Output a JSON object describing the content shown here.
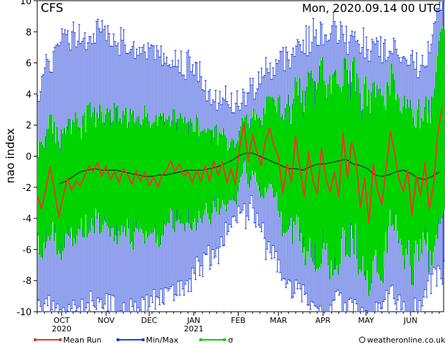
{
  "chart_data": {
    "type": "line",
    "title": "CFS",
    "run_label": "Mon, 2020.09.14   00 UTC",
    "ylabel": "nao index",
    "ylim": [
      -10,
      10
    ],
    "yticks": [
      "-10",
      "-8",
      "-6",
      "-4",
      "-2",
      "0",
      "2",
      "4",
      "6",
      "8",
      "10"
    ],
    "xlim_days": [
      0,
      283
    ],
    "month_ticks": [
      {
        "label": "OCT",
        "year": "2020",
        "day": 17
      },
      {
        "label": "NOV",
        "year": "",
        "day": 48
      },
      {
        "label": "DEC",
        "year": "",
        "day": 78
      },
      {
        "label": "JAN",
        "year": "2021",
        "day": 109
      },
      {
        "label": "FEB",
        "year": "",
        "day": 140
      },
      {
        "label": "MAR",
        "year": "",
        "day": 168
      },
      {
        "label": "APR",
        "year": "",
        "day": 199
      },
      {
        "label": "MAY",
        "year": "",
        "day": 229
      },
      {
        "label": "JUN",
        "year": "",
        "day": 260
      }
    ],
    "legend": [
      {
        "name": "Mean Run",
        "color": "#e03c28"
      },
      {
        "name": "Min/Max",
        "color": "#1f3fd8"
      },
      {
        "name": "σ",
        "color": "#00d400"
      }
    ],
    "series": {
      "mean_run_points": [
        [
          0,
          -2.5
        ],
        [
          3,
          -3.4
        ],
        [
          6,
          -2.1
        ],
        [
          9,
          -0.7
        ],
        [
          12,
          -2.2
        ],
        [
          15,
          -3.9
        ],
        [
          18,
          -2.6
        ],
        [
          21,
          -1.4
        ],
        [
          24,
          -2.2
        ],
        [
          27,
          -1.6
        ],
        [
          30,
          -1.9
        ],
        [
          33,
          -1.3
        ],
        [
          36,
          -0.6
        ],
        [
          39,
          -1.0
        ],
        [
          42,
          -0.4
        ],
        [
          45,
          -1.3
        ],
        [
          48,
          -0.6
        ],
        [
          51,
          -1.5
        ],
        [
          54,
          -1.0
        ],
        [
          57,
          -1.7
        ],
        [
          60,
          -0.8
        ],
        [
          63,
          -1.2
        ],
        [
          66,
          -1.8
        ],
        [
          69,
          -0.9
        ],
        [
          72,
          -1.6
        ],
        [
          75,
          -1.0
        ],
        [
          78,
          -1.9
        ],
        [
          81,
          -1.3
        ],
        [
          84,
          -2.0
        ],
        [
          87,
          -1.2
        ],
        [
          90,
          -0.9
        ],
        [
          93,
          -0.3
        ],
        [
          96,
          -1.0
        ],
        [
          99,
          -0.5
        ],
        [
          102,
          -1.3
        ],
        [
          105,
          -1.0
        ],
        [
          108,
          -1.7
        ],
        [
          111,
          -0.9
        ],
        [
          114,
          -1.6
        ],
        [
          117,
          -0.6
        ],
        [
          120,
          -1.6
        ],
        [
          123,
          -0.3
        ],
        [
          126,
          -1.2
        ],
        [
          129,
          -0.4
        ],
        [
          132,
          -1.7
        ],
        [
          135,
          -0.8
        ],
        [
          138,
          -1.8
        ],
        [
          141,
          0.6
        ],
        [
          144,
          2.1
        ],
        [
          147,
          -0.3
        ],
        [
          150,
          1.4
        ],
        [
          153,
          0.3
        ],
        [
          156,
          -0.6
        ],
        [
          159,
          1.0
        ],
        [
          162,
          1.8
        ],
        [
          165,
          0.6
        ],
        [
          168,
          0.0
        ],
        [
          171,
          -2.4
        ],
        [
          174,
          -0.5
        ],
        [
          177,
          -1.7
        ],
        [
          180,
          1.3
        ],
        [
          183,
          -0.8
        ],
        [
          186,
          -2.6
        ],
        [
          189,
          0.3
        ],
        [
          192,
          -1.6
        ],
        [
          195,
          -2.4
        ],
        [
          198,
          0.5
        ],
        [
          201,
          -1.4
        ],
        [
          204,
          -2.3
        ],
        [
          207,
          -1.0
        ],
        [
          210,
          -2.6
        ],
        [
          213,
          1.5
        ],
        [
          216,
          -1.4
        ],
        [
          219,
          0.9
        ],
        [
          222,
          -0.2
        ],
        [
          225,
          -3.3
        ],
        [
          228,
          -1.4
        ],
        [
          231,
          -4.3
        ],
        [
          234,
          -0.5
        ],
        [
          237,
          -2.2
        ],
        [
          240,
          -3.1
        ],
        [
          243,
          -0.8
        ],
        [
          246,
          1.6
        ],
        [
          249,
          0.2
        ],
        [
          252,
          -1.5
        ],
        [
          255,
          -2.3
        ],
        [
          258,
          -0.9
        ],
        [
          261,
          -3.8
        ],
        [
          264,
          -1.3
        ],
        [
          267,
          -2.5
        ],
        [
          270,
          -0.4
        ],
        [
          273,
          -3.4
        ],
        [
          276,
          -1.9
        ],
        [
          279,
          1.5
        ],
        [
          282,
          3.1
        ]
      ],
      "ensemble_mean_points": [
        [
          15,
          -1.8
        ],
        [
          20,
          -1.6
        ],
        [
          25,
          -1.3
        ],
        [
          30,
          -1.0
        ],
        [
          35,
          -0.9
        ],
        [
          40,
          -0.8
        ],
        [
          45,
          -0.9
        ],
        [
          50,
          -0.9
        ],
        [
          55,
          -0.9
        ],
        [
          60,
          -1.0
        ],
        [
          65,
          -1.1
        ],
        [
          70,
          -1.2
        ],
        [
          75,
          -1.3
        ],
        [
          80,
          -1.3
        ],
        [
          85,
          -1.2
        ],
        [
          90,
          -1.2
        ],
        [
          95,
          -1.1
        ],
        [
          100,
          -1.0
        ],
        [
          105,
          -0.9
        ],
        [
          110,
          -0.9
        ],
        [
          115,
          -0.9
        ],
        [
          120,
          -0.8
        ],
        [
          125,
          -0.7
        ],
        [
          130,
          -0.5
        ],
        [
          135,
          -0.3
        ],
        [
          140,
          0.0
        ],
        [
          145,
          0.2
        ],
        [
          150,
          0.2
        ],
        [
          155,
          0.0
        ],
        [
          160,
          -0.2
        ],
        [
          165,
          -0.4
        ],
        [
          170,
          -0.6
        ],
        [
          175,
          -0.8
        ],
        [
          180,
          -0.8
        ],
        [
          185,
          -0.9
        ],
        [
          190,
          -0.7
        ],
        [
          195,
          -0.5
        ],
        [
          200,
          -0.5
        ],
        [
          205,
          -0.4
        ],
        [
          210,
          -0.3
        ],
        [
          215,
          -0.2
        ],
        [
          220,
          -0.5
        ],
        [
          225,
          -0.6
        ],
        [
          230,
          -0.8
        ],
        [
          235,
          -1.2
        ],
        [
          240,
          -1.3
        ],
        [
          245,
          -1.2
        ],
        [
          250,
          -1.0
        ],
        [
          255,
          -0.9
        ],
        [
          260,
          -1.1
        ],
        [
          265,
          -1.4
        ],
        [
          270,
          -1.5
        ],
        [
          275,
          -1.3
        ],
        [
          280,
          -1.0
        ]
      ],
      "sigma_envelope": [
        [
          0,
          -5.5,
          0.5
        ],
        [
          10,
          -5.0,
          2.0
        ],
        [
          20,
          -4.8,
          2.5
        ],
        [
          30,
          -4.4,
          2.7
        ],
        [
          40,
          -4.3,
          2.8
        ],
        [
          50,
          -4.6,
          2.8
        ],
        [
          60,
          -4.8,
          2.7
        ],
        [
          70,
          -4.9,
          2.6
        ],
        [
          80,
          -4.8,
          2.5
        ],
        [
          90,
          -4.5,
          2.3
        ],
        [
          100,
          -4.2,
          2.2
        ],
        [
          110,
          -4.0,
          2.2
        ],
        [
          120,
          -3.6,
          1.6
        ],
        [
          130,
          -3.0,
          1.0
        ],
        [
          140,
          -1.8,
          1.2
        ],
        [
          150,
          -1.5,
          2.2
        ],
        [
          160,
          -2.5,
          2.8
        ],
        [
          170,
          -3.6,
          3.5
        ],
        [
          180,
          -4.6,
          3.8
        ],
        [
          190,
          -5.4,
          4.8
        ],
        [
          200,
          -6.0,
          5.6
        ],
        [
          210,
          -5.5,
          5.0
        ],
        [
          220,
          -5.8,
          5.0
        ],
        [
          230,
          -6.6,
          4.8
        ],
        [
          240,
          -5.8,
          4.4
        ],
        [
          250,
          -5.0,
          4.0
        ],
        [
          260,
          -6.4,
          3.2
        ],
        [
          270,
          -5.5,
          3.4
        ],
        [
          280,
          -4.2,
          6.8
        ]
      ],
      "minmax_envelope": [
        [
          0,
          -8.5,
          3.5
        ],
        [
          10,
          -9.2,
          5.6
        ],
        [
          20,
          -9.6,
          7.2
        ],
        [
          30,
          -9.0,
          6.8
        ],
        [
          40,
          -8.8,
          7.4
        ],
        [
          50,
          -8.6,
          7.0
        ],
        [
          60,
          -9.4,
          6.4
        ],
        [
          70,
          -8.9,
          6.2
        ],
        [
          80,
          -8.6,
          6.0
        ],
        [
          90,
          -8.2,
          5.6
        ],
        [
          100,
          -7.8,
          5.2
        ],
        [
          110,
          -7.0,
          5.0
        ],
        [
          120,
          -5.6,
          3.0
        ],
        [
          130,
          -4.6,
          2.6
        ],
        [
          140,
          -2.8,
          2.8
        ],
        [
          150,
          -2.6,
          3.6
        ],
        [
          160,
          -5.0,
          4.8
        ],
        [
          170,
          -6.6,
          5.4
        ],
        [
          180,
          -7.6,
          6.2
        ],
        [
          190,
          -8.8,
          6.8
        ],
        [
          200,
          -9.4,
          7.4
        ],
        [
          210,
          -8.6,
          7.2
        ],
        [
          220,
          -9.2,
          6.6
        ],
        [
          230,
          -9.8,
          6.4
        ],
        [
          240,
          -8.6,
          6.0
        ],
        [
          250,
          -8.2,
          5.8
        ],
        [
          260,
          -9.6,
          5.2
        ],
        [
          270,
          -8.4,
          5.0
        ],
        [
          280,
          -6.4,
          9.6
        ]
      ]
    }
  },
  "footer": {
    "credit": "weatheronline.co.uk"
  }
}
